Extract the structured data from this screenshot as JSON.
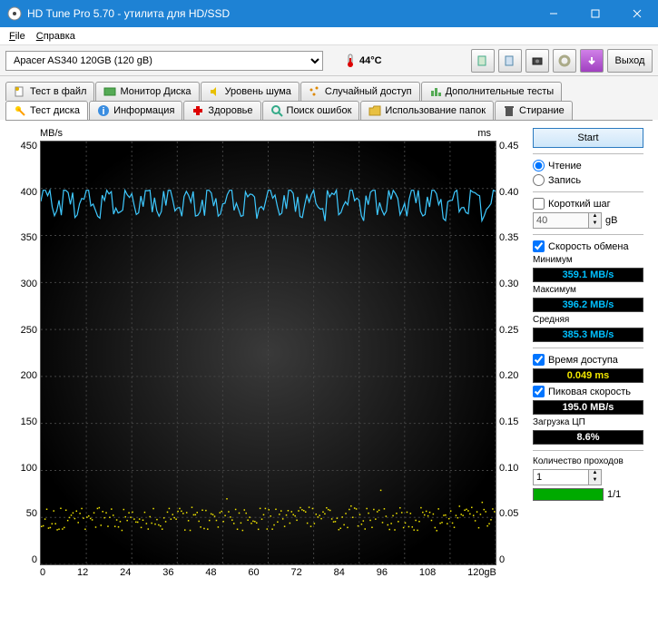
{
  "window": {
    "title": "HD Tune Pro 5.70 - утилита для HD/SSD"
  },
  "menu": {
    "file": "File",
    "help": "Справка"
  },
  "toolbar": {
    "drive": "Apacer AS340 120GB (120 gB)",
    "temp": "44°C",
    "exit": "Выход"
  },
  "tabs_top": [
    {
      "label": "Тест в файл"
    },
    {
      "label": "Монитор Диска"
    },
    {
      "label": "Уровень шума"
    },
    {
      "label": "Случайный доступ"
    },
    {
      "label": "Дополнительные  тесты"
    }
  ],
  "tabs_bottom": [
    {
      "label": "Тест диска"
    },
    {
      "label": "Информация"
    },
    {
      "label": "Здоровье"
    },
    {
      "label": "Поиск ошибок"
    },
    {
      "label": "Использование папок"
    },
    {
      "label": "Стирание"
    }
  ],
  "chart_data": {
    "type": "line",
    "title": "",
    "xlabel": "gB",
    "x_min": 0,
    "x_max": 120,
    "x_ticks": [
      "0",
      "12",
      "24",
      "36",
      "48",
      "60",
      "72",
      "84",
      "96",
      "108",
      "120gB"
    ],
    "left_axis": {
      "label": "MB/s",
      "min": 0,
      "max": 450,
      "ticks": [
        "450",
        "400",
        "350",
        "300",
        "250",
        "200",
        "150",
        "100",
        "50",
        "0"
      ]
    },
    "right_axis": {
      "label": "ms",
      "min": 0,
      "max": 0.45,
      "ticks": [
        "0.45",
        "0.40",
        "0.35",
        "0.30",
        "0.25",
        "0.20",
        "0.15",
        "0.10",
        "0.05",
        "0"
      ]
    },
    "series": [
      {
        "name": "Transfer rate (MB/s)",
        "color": "#3ec9ff",
        "avg": 385.3,
        "min": 359.1,
        "max": 396.2
      },
      {
        "name": "Access time (ms)",
        "color": "#f2e600",
        "avg": 0.049,
        "typical_range": [
          0.03,
          0.07
        ]
      }
    ]
  },
  "panel": {
    "start": "Start",
    "read": "Чтение",
    "write": "Запись",
    "short_step": "Короткий шаг",
    "step_value": "40",
    "step_unit": "gB",
    "transfer_rate": "Скорость обмена",
    "min_label": "Минимум",
    "min_value": "359.1 MB/s",
    "max_label": "Максимум",
    "max_value": "396.2 MB/s",
    "avg_label": "Средняя",
    "avg_value": "385.3 MB/s",
    "access_time": "Время доступа",
    "access_value": "0.049 ms",
    "burst": "Пиковая скорость",
    "burst_value": "195.0 MB/s",
    "cpu": "Загрузка ЦП",
    "cpu_value": "8.6%",
    "passes_label": "Количество проходов",
    "passes_value": "1",
    "progress_text": "1/1"
  }
}
